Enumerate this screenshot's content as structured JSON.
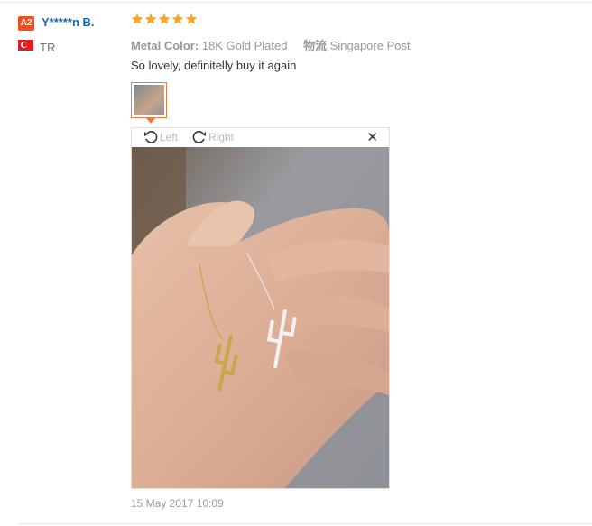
{
  "review": {
    "user": {
      "level_badge": "A2",
      "name": "Y*****n B.",
      "country_code": "TR",
      "flag_icon": "turkey-flag-icon"
    },
    "rating": {
      "stars": 5,
      "max": 5,
      "color": "#f5a623"
    },
    "attributes": {
      "color_label": "Metal Color:",
      "color_value": "18K Gold Plated",
      "shipping_label": "物流",
      "shipping_value": "Singapore Post"
    },
    "text": "So lovely, definitelly buy it again",
    "viewer": {
      "rotate_left_label": "Left",
      "rotate_right_label": "Right",
      "close_symbol": "✕"
    },
    "date": "15 May 2017 10:09"
  },
  "colors": {
    "accent": "#e8521f",
    "link": "#1a66b3",
    "thumb_border": "#f07a3c"
  }
}
